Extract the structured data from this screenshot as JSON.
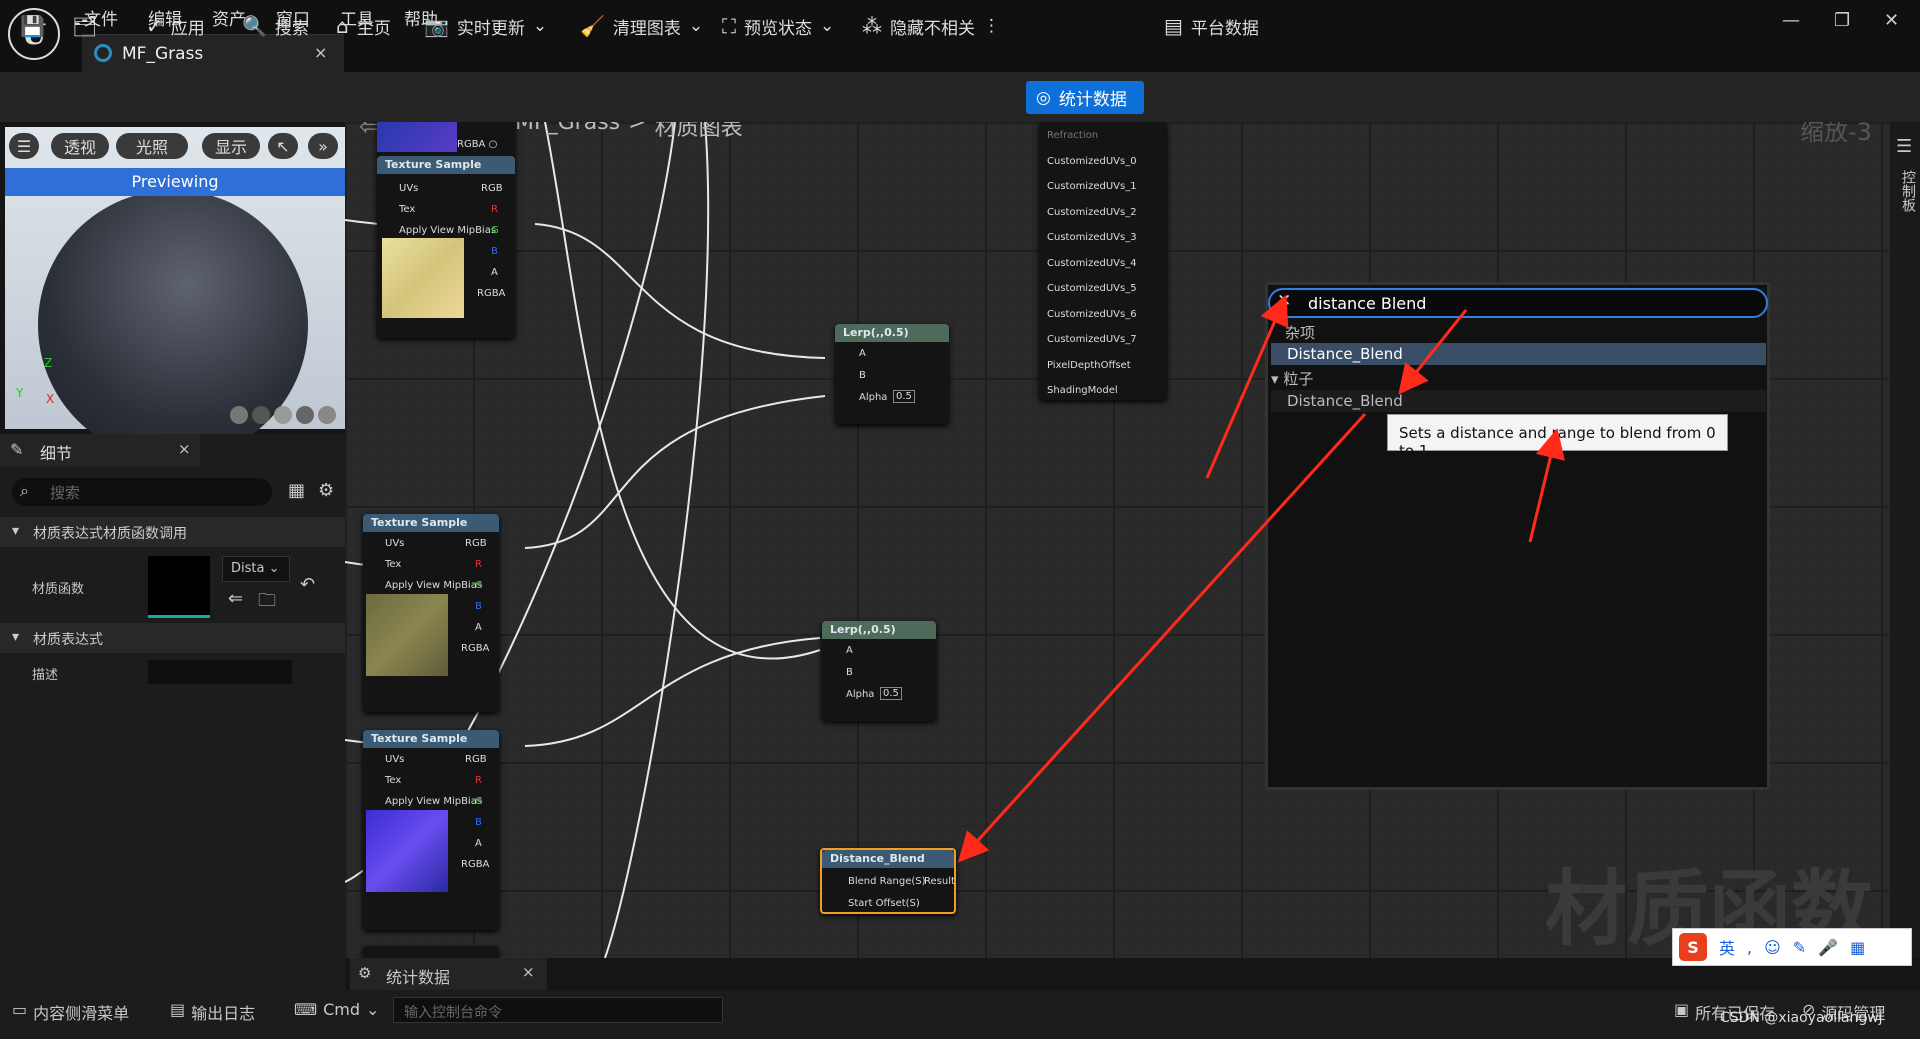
{
  "menu": [
    "文件",
    "编辑",
    "资产",
    "窗口",
    "工具",
    "帮助"
  ],
  "tab": {
    "title": "MF_Grass",
    "close": "×"
  },
  "toolbar": {
    "apply": "应用",
    "search": "搜索",
    "home": "主页",
    "live_update": "实时更新",
    "clean_graph": "清理图表",
    "preview_state": "预览状态",
    "hide_unrelated": "隐藏不相关",
    "stats": "统计数据",
    "platform_stats": "平台数据"
  },
  "viewport": {
    "perspective": "透视",
    "lit": "光照",
    "show": "显示",
    "previewing": "Previewing",
    "axis_z": "Z",
    "axis_y": "Y",
    "axis_x": "X"
  },
  "details": {
    "title": "细节",
    "search_placeholder": "搜索",
    "section1": "材质表达式材质函数调用",
    "func_label": "材质函数",
    "func_value": "Dista",
    "section2": "材质表达式",
    "desc_label": "描述"
  },
  "graph": {
    "breadcrumb_root": "MF_Grass",
    "breadcrumb_sep": ">",
    "breadcrumb_page": "材质图表",
    "zoom": "缩放-3",
    "watermark": "材质函数",
    "side_label": "控制板"
  },
  "nodes": {
    "texture_sample": "Texture Sample",
    "pins": {
      "uvs": "UVs",
      "tex": "Tex",
      "mip": "Apply View MipBias",
      "rgb": "RGB",
      "r": "R",
      "g": "G",
      "b": "B",
      "a": "A",
      "rgba": "RGBA"
    },
    "lerp": "Lerp(,,0.5)",
    "pin_a": "A",
    "pin_b": "B",
    "alpha": "Alpha",
    "alpha_val": "0.5",
    "distance_blend": "Distance_Blend",
    "blend_range": "Blend Range(S)",
    "result": "Result",
    "start_offset": "Start Offset(S)"
  },
  "result_pins": [
    "Refraction",
    "CustomizedUVs_0",
    "CustomizedUVs_1",
    "CustomizedUVs_2",
    "CustomizedUVs_3",
    "CustomizedUVs_4",
    "CustomizedUVs_5",
    "CustomizedUVs_6",
    "CustomizedUVs_7",
    "PixelDepthOffset",
    "ShadingModel"
  ],
  "search_panel": {
    "query": "distance Blend",
    "cat_misc": "杂项",
    "item1": "Distance_Blend",
    "cat_particle": "粒子",
    "item2": "Distance_Blend",
    "tooltip": "Sets a distance and range to blend from 0 to 1"
  },
  "bottom": {
    "content_drawer": "内容侧滑菜单",
    "output_log": "输出日志",
    "cmd": "Cmd",
    "console_placeholder": "输入控制台命令",
    "stats_tab": "统计数据",
    "all_saved": "所有已保存",
    "source_control": "源码管理",
    "credit": "CSDN @xiaoyaoliangwj"
  },
  "ime": {
    "lang": "英"
  },
  "colors": {
    "accent": "#0d6fd8",
    "arrow": "#ff2a1a",
    "node_header": "#3a5b73",
    "selected_node": "#f0a020"
  }
}
